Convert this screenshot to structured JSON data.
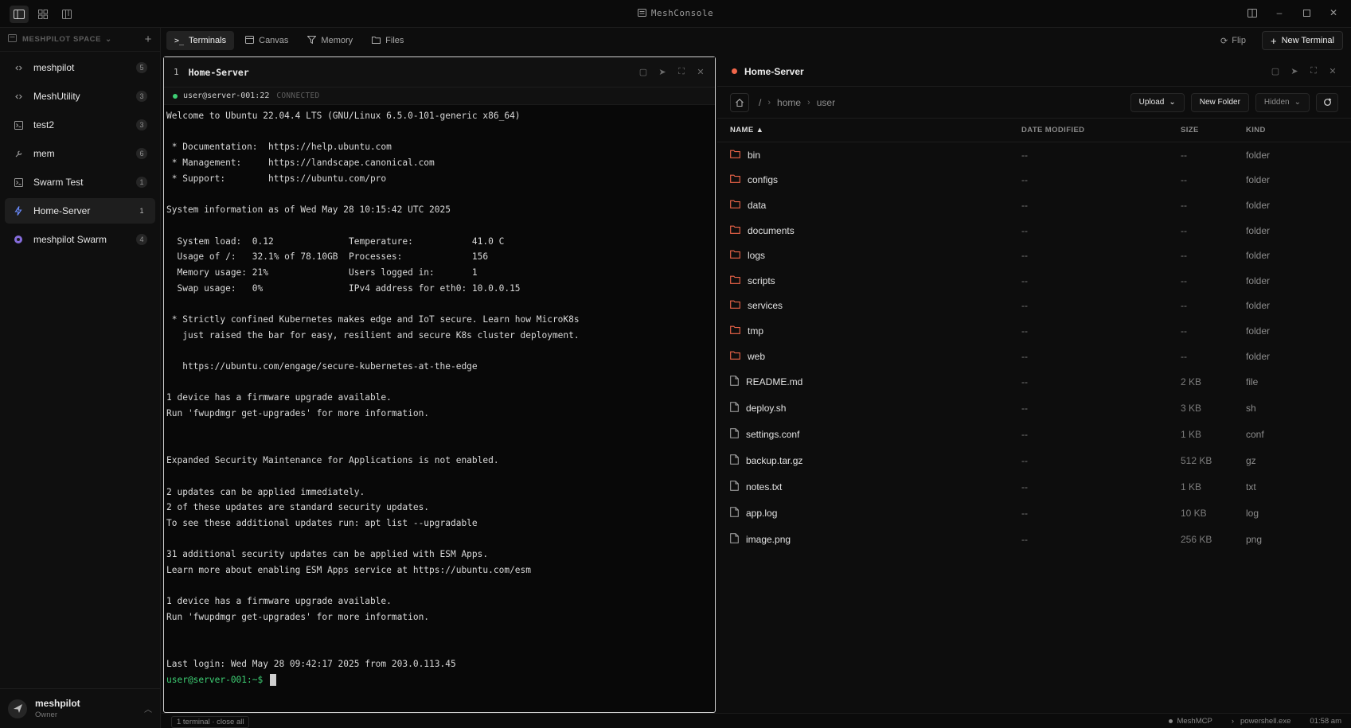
{
  "app": {
    "title": "MeshConsole"
  },
  "sidebar": {
    "space_label": "MESHPILOT SPACE",
    "items": [
      {
        "label": "meshpilot",
        "count": "5",
        "icon": "link-icon"
      },
      {
        "label": "MeshUtility",
        "count": "3",
        "icon": "link-icon"
      },
      {
        "label": "test2",
        "count": "3",
        "icon": "terminal-box-icon"
      },
      {
        "label": "mem",
        "count": "6",
        "icon": "wrench-icon"
      },
      {
        "label": "Swarm Test",
        "count": "1",
        "icon": "terminal-box-icon"
      },
      {
        "label": "Home-Server",
        "count": "1",
        "icon": "bolt-icon"
      },
      {
        "label": "meshpilot Swarm",
        "count": "4",
        "icon": "swarm-icon"
      }
    ],
    "active_index": 5,
    "user": {
      "name": "meshpilot",
      "role": "Owner"
    }
  },
  "tabs": [
    {
      "label": "Terminals",
      "icon": "prompt-icon"
    },
    {
      "label": "Canvas",
      "icon": "canvas-icon"
    },
    {
      "label": "Memory",
      "icon": "filter-icon"
    },
    {
      "label": "Files",
      "icon": "folder-icon"
    }
  ],
  "active_tab": 0,
  "top_actions": {
    "flip": "Flip",
    "new_terminal": "New Terminal"
  },
  "terminal": {
    "number": "1",
    "name": "Home-Server",
    "host": "user@server-001:22",
    "state": "CONNECTED",
    "lines": [
      "Welcome to Ubuntu 22.04.4 LTS (GNU/Linux 6.5.0-101-generic x86_64)",
      "",
      " * Documentation:  https://help.ubuntu.com",
      " * Management:     https://landscape.canonical.com",
      " * Support:        https://ubuntu.com/pro",
      "",
      "System information as of Wed May 28 10:15:42 UTC 2025",
      "",
      "  System load:  0.12              Temperature:           41.0 C",
      "  Usage of /:   32.1% of 78.10GB  Processes:             156",
      "  Memory usage: 21%               Users logged in:       1",
      "  Swap usage:   0%                IPv4 address for eth0: 10.0.0.15",
      "",
      " * Strictly confined Kubernetes makes edge and IoT secure. Learn how MicroK8s",
      "   just raised the bar for easy, resilient and secure K8s cluster deployment.",
      "",
      "   https://ubuntu.com/engage/secure-kubernetes-at-the-edge",
      "",
      "1 device has a firmware upgrade available.",
      "Run 'fwupdmgr get-upgrades' for more information.",
      "",
      "",
      "Expanded Security Maintenance for Applications is not enabled.",
      "",
      "2 updates can be applied immediately.",
      "2 of these updates are standard security updates.",
      "To see these additional updates run: apt list --upgradable",
      "",
      "31 additional security updates can be applied with ESM Apps.",
      "Learn more about enabling ESM Apps service at https://ubuntu.com/esm",
      "",
      "1 device has a firmware upgrade available.",
      "Run 'fwupdmgr get-upgrades' for more information.",
      "",
      "",
      "Last login: Wed May 28 09:42:17 2025 from 203.0.113.45"
    ],
    "prompt": "user@server-001:~$"
  },
  "files": {
    "title": "Home-Server",
    "breadcrumb": [
      "/",
      "home",
      "user"
    ],
    "buttons": {
      "upload": "Upload",
      "new_folder": "New Folder",
      "hidden": "Hidden"
    },
    "columns": {
      "name": "NAME",
      "date": "DATE MODIFIED",
      "size": "SIZE",
      "kind": "KIND"
    },
    "rows": [
      {
        "name": "bin",
        "date": "--",
        "size": "--",
        "kind": "folder",
        "type": "folder"
      },
      {
        "name": "configs",
        "date": "--",
        "size": "--",
        "kind": "folder",
        "type": "folder"
      },
      {
        "name": "data",
        "date": "--",
        "size": "--",
        "kind": "folder",
        "type": "folder"
      },
      {
        "name": "documents",
        "date": "--",
        "size": "--",
        "kind": "folder",
        "type": "folder"
      },
      {
        "name": "logs",
        "date": "--",
        "size": "--",
        "kind": "folder",
        "type": "folder"
      },
      {
        "name": "scripts",
        "date": "--",
        "size": "--",
        "kind": "folder",
        "type": "folder"
      },
      {
        "name": "services",
        "date": "--",
        "size": "--",
        "kind": "folder",
        "type": "folder"
      },
      {
        "name": "tmp",
        "date": "--",
        "size": "--",
        "kind": "folder",
        "type": "folder"
      },
      {
        "name": "web",
        "date": "--",
        "size": "--",
        "kind": "folder",
        "type": "folder"
      },
      {
        "name": "README.md",
        "date": "--",
        "size": "2 KB",
        "kind": "file",
        "type": "file"
      },
      {
        "name": "deploy.sh",
        "date": "--",
        "size": "3 KB",
        "kind": "sh",
        "type": "file"
      },
      {
        "name": "settings.conf",
        "date": "--",
        "size": "1 KB",
        "kind": "conf",
        "type": "file"
      },
      {
        "name": "backup.tar.gz",
        "date": "--",
        "size": "512 KB",
        "kind": "gz",
        "type": "file"
      },
      {
        "name": "notes.txt",
        "date": "--",
        "size": "1 KB",
        "kind": "txt",
        "type": "file"
      },
      {
        "name": "app.log",
        "date": "--",
        "size": "10 KB",
        "kind": "log",
        "type": "file"
      },
      {
        "name": "image.png",
        "date": "--",
        "size": "256 KB",
        "kind": "png",
        "type": "file"
      }
    ]
  },
  "status": {
    "left": "1 terminal · close all",
    "mcp": "MeshMCP",
    "shell": "powershell.exe",
    "time": "01:58 am"
  },
  "colors": {
    "accent_green": "#3ecf74",
    "folder_orange": "#f0664a",
    "active_bolt": "#6b8cff"
  }
}
